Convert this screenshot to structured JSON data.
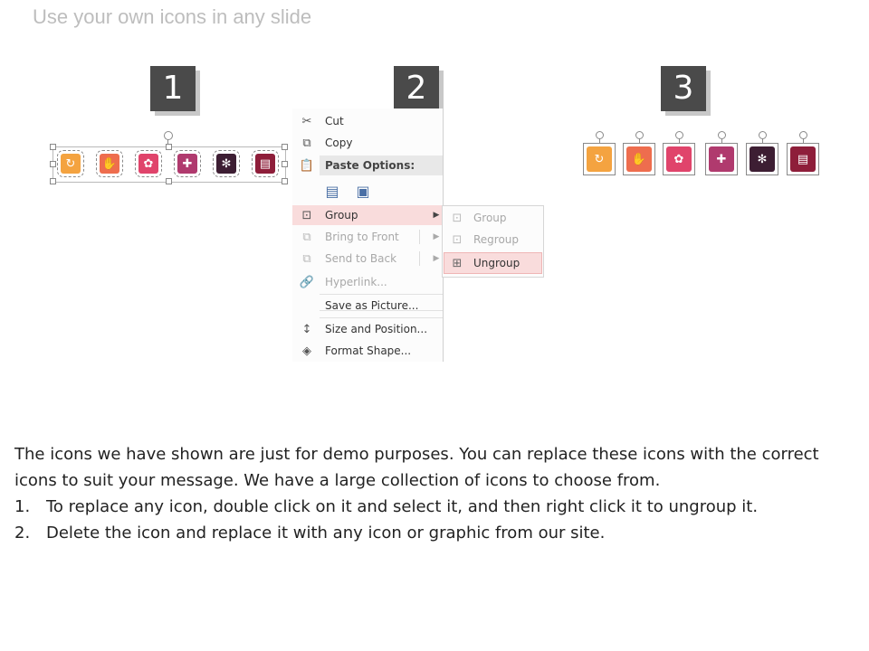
{
  "slide": {
    "title": "Use your own icons in any slide"
  },
  "steps": [
    "1",
    "2",
    "3"
  ],
  "colors": {
    "orange": "#f4a340",
    "coral": "#ee6d4e",
    "pink": "#e0446b",
    "magenta": "#b03a6e",
    "dark_plum": "#3d1e33",
    "maroon": "#8e1e3a",
    "menu_hover": "#f9dcdc"
  },
  "icons_step1": [
    {
      "icon": "refresh-icon",
      "color": "#f4a340",
      "glyph": "↻"
    },
    {
      "icon": "hand-icon",
      "color": "#ee6d4e",
      "glyph": "✋"
    },
    {
      "icon": "idea-icon",
      "color": "#e0446b",
      "glyph": "✿"
    },
    {
      "icon": "puzzle-icon",
      "color": "#b03a6e",
      "glyph": "✚"
    },
    {
      "icon": "gear-icon",
      "color": "#3d1e33",
      "glyph": "✻"
    },
    {
      "icon": "document-icon",
      "color": "#8e1e3a",
      "glyph": "▤"
    }
  ],
  "context_menu": {
    "cut": "Cut",
    "copy": "Copy",
    "paste_options": "Paste Options:",
    "group": "Group",
    "bring_to_front": "Bring to Front",
    "send_to_back": "Send to Back",
    "hyperlink": "Hyperlink...",
    "save_as_picture": "Save as Picture...",
    "size_and_position": "Size and Position...",
    "format_shape": "Format Shape..."
  },
  "submenu": {
    "group": "Group",
    "regroup": "Regroup",
    "ungroup": "Ungroup"
  },
  "body": {
    "intro": "The icons we have shown are just for demo purposes. You can replace these icons with the correct icons to suit your message. We have a large collection of icons to choose from.",
    "item1_num": "1.",
    "item1": "To replace any icon, double click on it and select it, and then right click it to ungroup it.",
    "item2_num": "2.",
    "item2": "Delete the icon and replace it with any icon or graphic from our site."
  }
}
